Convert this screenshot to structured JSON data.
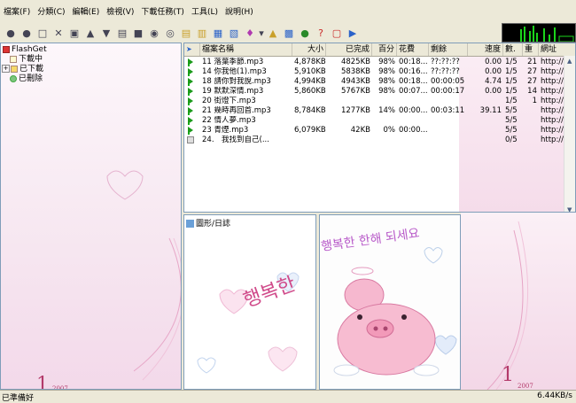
{
  "menu": [
    "檔案(F)",
    "分類(C)",
    "編輯(E)",
    "檢視(V)",
    "下載任務(T)",
    "工具(L)",
    "說明(H)"
  ],
  "tree": {
    "root": "FlashGet",
    "items": [
      "下載中",
      "已下載",
      "已刪除"
    ]
  },
  "decor_year": "2007",
  "decor_number": "1",
  "list": {
    "headers": [
      "檔案名稱",
      "大小",
      "已完成",
      "百分",
      "花費",
      "剩餘",
      "速度",
      "數.",
      "重",
      "網址"
    ],
    "rows": [
      {
        "state": "active",
        "name": "11 落葉季節.mp3",
        "size": "4,878KB",
        "done": "4825KB",
        "pct": "98%",
        "spent": "00:18...",
        "left": "??:??:??",
        "speed": "0.00",
        "parts": "1/5",
        "retry": "21",
        "url": "http://bbs."
      },
      {
        "state": "active",
        "name": "14 你我他(1).mp3",
        "size": "5,910KB",
        "done": "5838KB",
        "pct": "98%",
        "spent": "00:16...",
        "left": "??:??:??",
        "speed": "0.00",
        "parts": "1/5",
        "retry": "27",
        "url": "http://bbs."
      },
      {
        "state": "active",
        "name": "18 請你對我說.mp3",
        "size": "4,994KB",
        "done": "4943KB",
        "pct": "98%",
        "spent": "00:18...",
        "left": "00:00:05",
        "speed": "4.74",
        "parts": "1/5",
        "retry": "27",
        "url": "http://bbs."
      },
      {
        "state": "active",
        "name": "19 默默深情.mp3",
        "size": "5,860KB",
        "done": "5767KB",
        "pct": "98%",
        "spent": "00:07...",
        "left": "00:00:17",
        "speed": "0.00",
        "parts": "1/5",
        "retry": "14",
        "url": "http://bbs."
      },
      {
        "state": "active",
        "name": "20 街燈下.mp3",
        "size": "",
        "done": "",
        "pct": "",
        "spent": "",
        "left": "",
        "speed": "",
        "parts": "1/5",
        "retry": "1",
        "url": "http://bbs."
      },
      {
        "state": "active",
        "name": "21 幾時再回首.mp3",
        "size": "8,784KB",
        "done": "1277KB",
        "pct": "14%",
        "spent": "00:00...",
        "left": "00:03:11",
        "speed": "39.11",
        "parts": "5/5",
        "retry": "",
        "url": "http://bbs."
      },
      {
        "state": "active",
        "name": "22 情人夢.mp3",
        "size": "",
        "done": "",
        "pct": "",
        "spent": "",
        "left": "",
        "speed": "",
        "parts": "5/5",
        "retry": "",
        "url": "http://bbs."
      },
      {
        "state": "active",
        "name": "23 青煙.mp3",
        "size": "6,079KB",
        "done": "42KB",
        "pct": "0%",
        "spent": "00:00...",
        "left": "",
        "speed": "",
        "parts": "5/5",
        "retry": "",
        "url": "http://bbs."
      },
      {
        "state": "pending",
        "name": "24.　我找到自己(...",
        "size": "",
        "done": "",
        "pct": "",
        "spent": "",
        "left": "",
        "speed": "",
        "parts": "0/5",
        "retry": "",
        "url": "http://bbs."
      }
    ]
  },
  "graph": {
    "title": "圖形/日誌"
  },
  "picture": {
    "text": "행복한 한해 되세요"
  },
  "status": {
    "text": "已準備好",
    "speed": "6.44KB/s"
  },
  "colors": {
    "accent": "#d04a8a",
    "active_icon": "#1a9a1a",
    "menu_bg": "#ece9d8"
  }
}
